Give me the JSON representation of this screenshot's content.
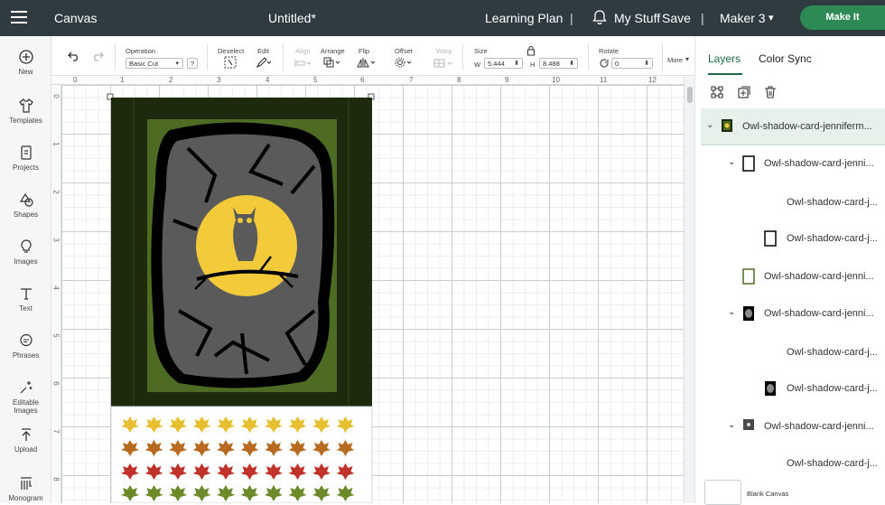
{
  "topbar": {
    "app_section": "Canvas",
    "doc_title": "Untitled*",
    "learning": "Learning Plan",
    "sep": "|",
    "mystuff": "My Stuff",
    "save": "Save",
    "machine": "Maker 3",
    "makeit": "Make It"
  },
  "leftnav": [
    {
      "label": "New",
      "icon": "plus-circle-icon"
    },
    {
      "label": "Templates",
      "icon": "tshirt-icon"
    },
    {
      "label": "Projects",
      "icon": "projects-icon"
    },
    {
      "label": "Shapes",
      "icon": "shapes-icon"
    },
    {
      "label": "Images",
      "icon": "lightbulb-icon"
    },
    {
      "label": "Text",
      "icon": "text-icon"
    },
    {
      "label": "Phrases",
      "icon": "speech-bubble-icon"
    },
    {
      "label": "Editable Images",
      "icon": "sparkle-icon"
    },
    {
      "label": "Upload",
      "icon": "upload-icon"
    },
    {
      "label": "Monogram",
      "icon": "monogram-icon"
    }
  ],
  "toolbar": {
    "operation_label": "Operation",
    "operation_value": "Basic Cut",
    "operation_help": "?",
    "deselect": "Deselect",
    "edit": "Edit",
    "align": "Align",
    "arrange": "Arrange",
    "flip": "Flip",
    "offset": "Offset",
    "warp": "Warp",
    "size_label": "Size",
    "w_label": "W",
    "w_value": "5.444",
    "h_label": "H",
    "h_value": "8.488",
    "rotate_label": "Rotate",
    "rotate_value": "0",
    "more": "More"
  },
  "ruler": {
    "h": [
      "0",
      "1",
      "2",
      "3",
      "4",
      "5",
      "6",
      "7",
      "8",
      "9",
      "10",
      "11",
      "12"
    ],
    "v": [
      "0",
      "1",
      "2",
      "3",
      "4",
      "5",
      "6",
      "7",
      "8"
    ]
  },
  "rpanel": {
    "tabs": [
      "Layers",
      "Color Sync"
    ],
    "tools": [
      "group-icon",
      "duplicate-icon",
      "delete-icon"
    ],
    "layers": [
      {
        "name": "Owl-shadow-card-jenniferm...",
        "caret": "⌄",
        "thumb": "owl-card"
      },
      {
        "name": "Owl-shadow-card-jenni...",
        "caret": "⌄",
        "thumb": "frame-black"
      },
      {
        "name": "Owl-shadow-card-j...",
        "caret": "",
        "thumb": "none"
      },
      {
        "name": "Owl-shadow-card-j...",
        "caret": "",
        "thumb": "frame-black"
      },
      {
        "name": "Owl-shadow-card-jenni...",
        "caret": "",
        "thumb": "frame-green"
      },
      {
        "name": "Owl-shadow-card-jenni...",
        "caret": "⌄",
        "thumb": "tree-layer"
      },
      {
        "name": "Owl-shadow-card-j...",
        "caret": "",
        "thumb": "none"
      },
      {
        "name": "Owl-shadow-card-j...",
        "caret": "",
        "thumb": "tree-layer"
      },
      {
        "name": "Owl-shadow-card-jenni...",
        "caret": "⌄",
        "thumb": "owl-small"
      },
      {
        "name": "Owl-shadow-card-j...",
        "caret": "",
        "thumb": "none"
      }
    ],
    "blank_canvas": "Blank Canvas"
  },
  "colors": {
    "topbar": "#2f3b40",
    "makeit": "#2e8a55",
    "card_dark": "#1e2a0d",
    "card_green": "#4d6b22",
    "rock": "#5a5a5a",
    "moon": "#f2ca3a",
    "leaf_yellow": "#e7c032",
    "leaf_orange": "#b86b20",
    "leaf_red": "#c0332a",
    "leaf_green": "#6c8a2a"
  }
}
